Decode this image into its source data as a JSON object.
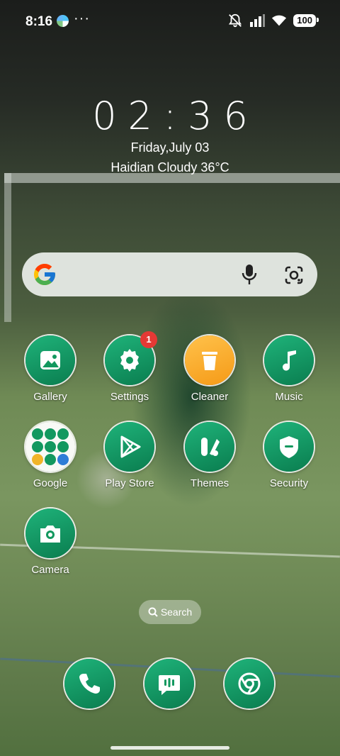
{
  "status_bar": {
    "time": "8:16",
    "more": "···",
    "battery": "100"
  },
  "clock": {
    "time": "02:36",
    "date": "Friday,July 03",
    "weather": "Haidian Cloudy 36°C"
  },
  "search_bar": {
    "icons": [
      "google-logo",
      "mic-icon",
      "lens-icon"
    ]
  },
  "apps": [
    {
      "label": "Gallery",
      "icon": "image-icon"
    },
    {
      "label": "Settings",
      "icon": "gear-icon",
      "badge": "1"
    },
    {
      "label": "Cleaner",
      "icon": "trash-icon"
    },
    {
      "label": "Music",
      "icon": "music-note-icon"
    },
    {
      "label": "Google",
      "icon": "folder-icon"
    },
    {
      "label": "Play Store",
      "icon": "play-icon"
    },
    {
      "label": "Themes",
      "icon": "themes-icon"
    },
    {
      "label": "Security",
      "icon": "shield-icon"
    },
    {
      "label": "Camera",
      "icon": "camera-icon"
    }
  ],
  "search_pill": {
    "label": "Search"
  },
  "dock": [
    {
      "name": "Phone",
      "icon": "phone-icon"
    },
    {
      "name": "Messages",
      "icon": "message-icon"
    },
    {
      "name": "Chrome",
      "icon": "chrome-icon"
    }
  ],
  "colors": {
    "app_green": "#12985f",
    "cleaner_orange": "#f7a41e",
    "badge_red": "#e53935"
  }
}
